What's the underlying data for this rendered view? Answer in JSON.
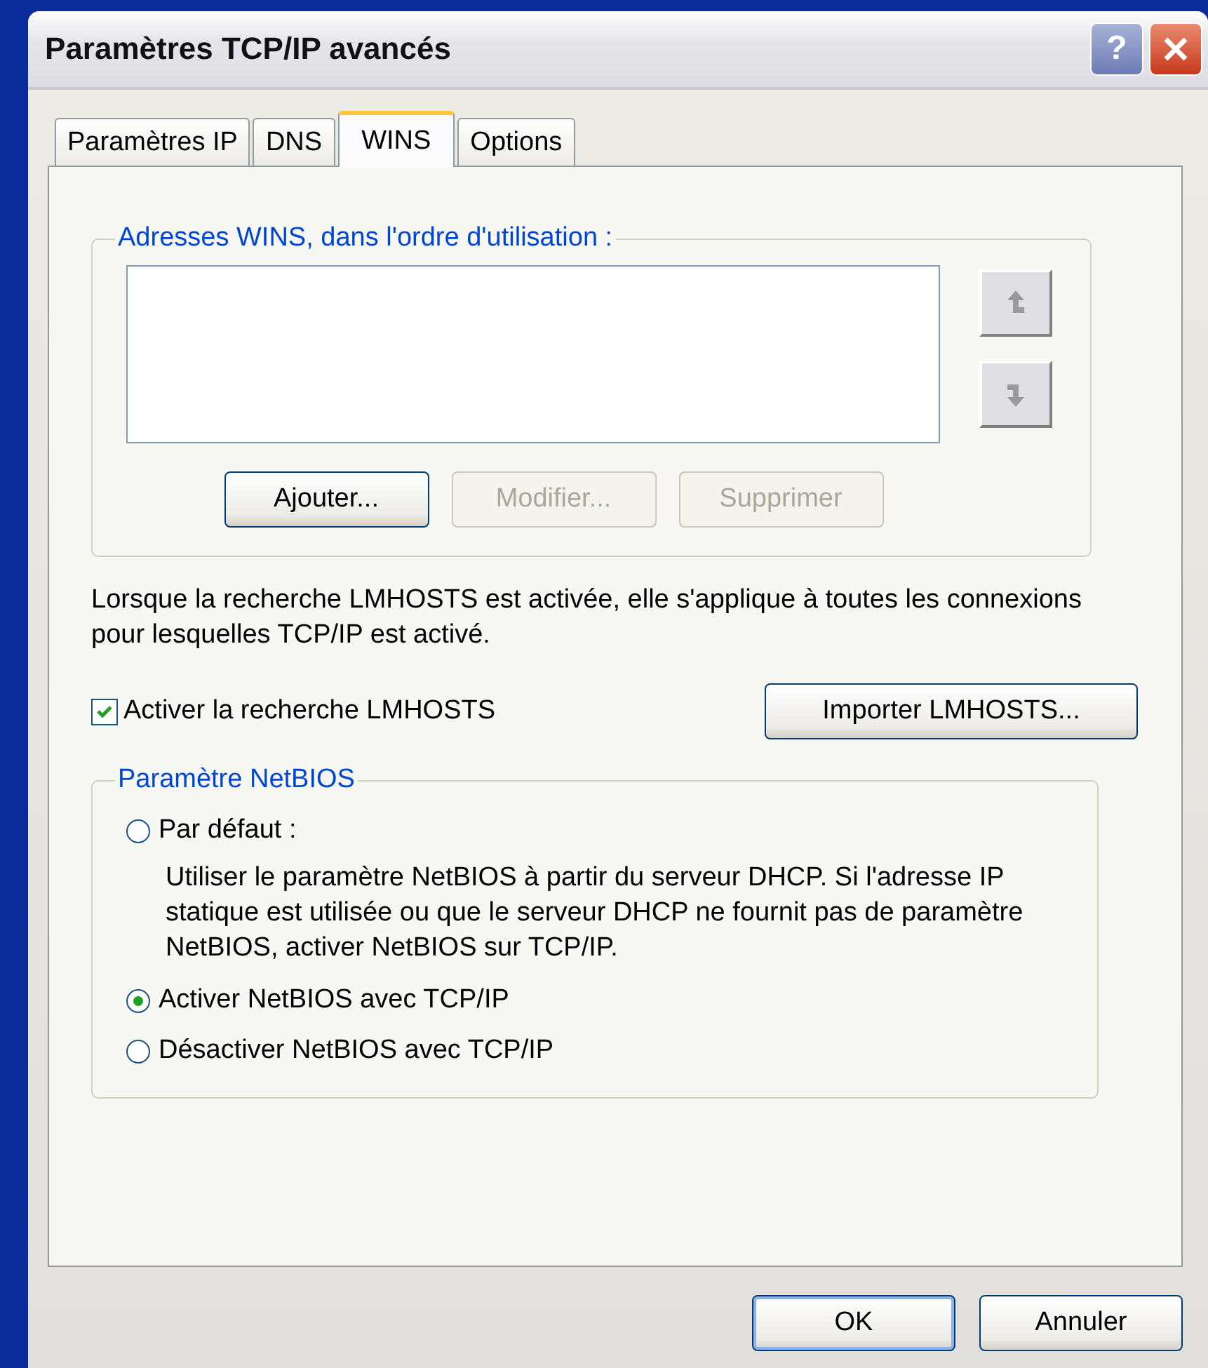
{
  "window": {
    "title": "Paramètres TCP/IP avancés",
    "title_buttons": [
      {
        "kind": "help",
        "label": "?"
      },
      {
        "kind": "close"
      }
    ]
  },
  "tabs": [
    {
      "label": "Paramètres IP",
      "selected": false
    },
    {
      "label": "DNS",
      "selected": false
    },
    {
      "label": "WINS",
      "selected": true
    },
    {
      "label": "Options",
      "selected": false
    }
  ],
  "wins_group": {
    "legend": "Adresses WINS, dans l'ordre d'utilisation :",
    "order_buttons": [
      {
        "kind": "up",
        "disabled": true
      },
      {
        "kind": "down",
        "disabled": true
      }
    ],
    "buttons": [
      {
        "label": "Ajouter...",
        "disabled": false
      },
      {
        "label": "Modifier...",
        "disabled": true
      },
      {
        "label": "Supprimer",
        "disabled": true
      }
    ]
  },
  "lmhosts_note": "Lorsque la recherche LMHOSTS est activée, elle s'applique à toutes les connexions pour lesquelles TCP/IP est activé.",
  "lmhosts_checkbox": {
    "label": "Activer la recherche LMHOSTS",
    "checked": true
  },
  "import_button": {
    "label": "Importer LMHOSTS..."
  },
  "netbios_group": {
    "legend": "Paramètre NetBIOS",
    "options": [
      {
        "label": "Par défaut :",
        "selected": false,
        "description": "Utiliser le paramètre NetBIOS à partir du serveur DHCP. Si l'adresse IP statique est utilisée ou que le serveur DHCP ne fournit pas de paramètre NetBIOS, activer NetBIOS sur TCP/IP."
      },
      {
        "label": "Activer NetBIOS avec TCP/IP",
        "selected": true
      },
      {
        "label": "Désactiver NetBIOS avec TCP/IP",
        "selected": false
      }
    ]
  },
  "footer_buttons": [
    {
      "label": "OK",
      "default": true
    },
    {
      "label": "Annuler",
      "default": false
    }
  ]
}
